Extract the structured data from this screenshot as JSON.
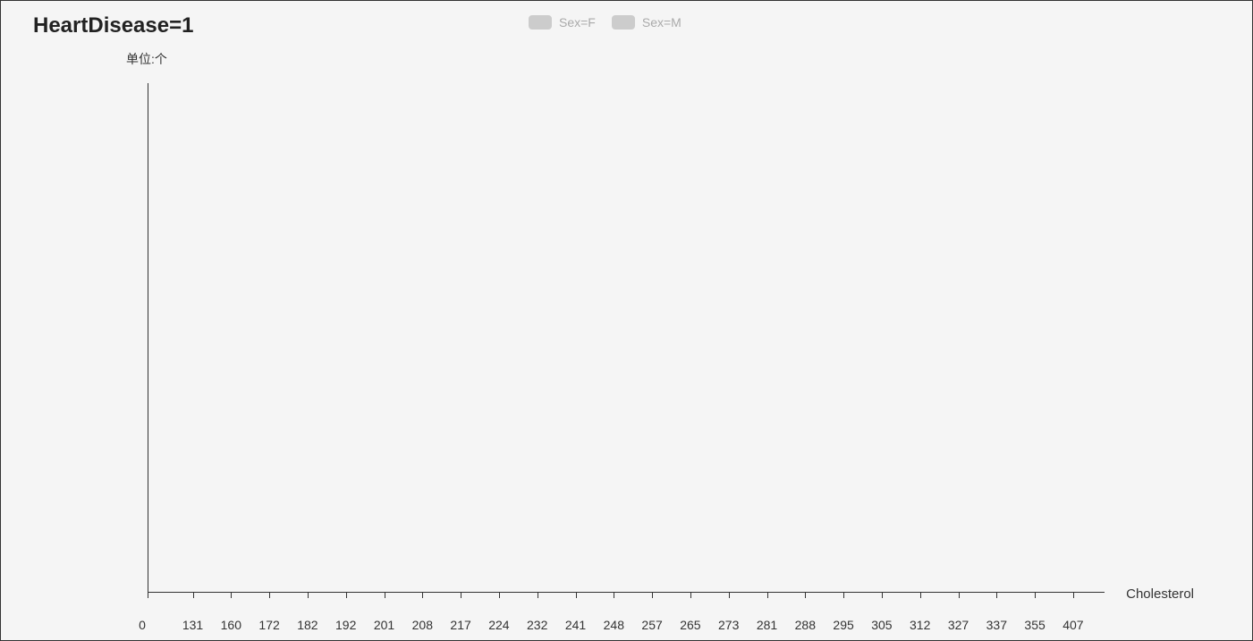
{
  "chart_data": {
    "type": "bar",
    "title": "HeartDisease=1",
    "y_unit_label": "单位:个",
    "xlabel": "Cholesterol",
    "ylabel": "",
    "categories": [
      "0",
      "131",
      "160",
      "172",
      "182",
      "192",
      "201",
      "208",
      "217",
      "224",
      "232",
      "241",
      "248",
      "257",
      "265",
      "273",
      "281",
      "288",
      "295",
      "305",
      "312",
      "327",
      "337",
      "355",
      "407"
    ],
    "series": [
      {
        "name": "Sex=F",
        "values": [],
        "visible": false
      },
      {
        "name": "Sex=M",
        "values": [],
        "visible": false
      }
    ],
    "legend_position": "top"
  },
  "legend": {
    "items": [
      {
        "label": "Sex=F"
      },
      {
        "label": "Sex=M"
      }
    ]
  }
}
